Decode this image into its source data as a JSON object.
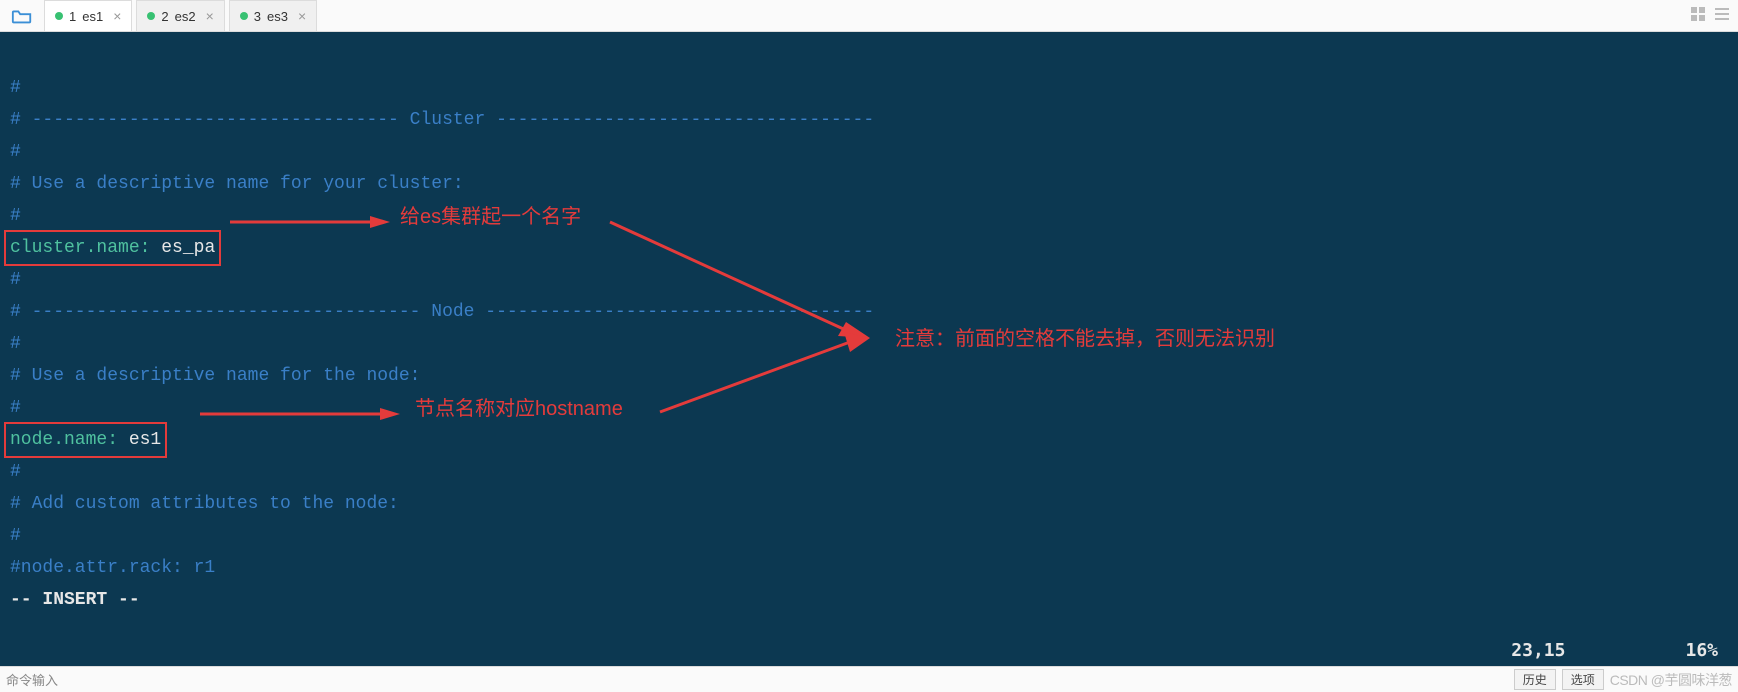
{
  "tabs": [
    {
      "index": "1",
      "name": "es1",
      "active": true
    },
    {
      "index": "2",
      "name": "es2",
      "active": false
    },
    {
      "index": "3",
      "name": "es3",
      "active": false
    }
  ],
  "lines": {
    "l1": "#",
    "l2": "# ---------------------------------- Cluster -----------------------------------",
    "l3": "#",
    "l4": "# Use a descriptive name for your cluster:",
    "l5": "#",
    "l6_key": "cluster.name:",
    "l6_val": " es_pa",
    "l7": "#",
    "l8": "# ------------------------------------ Node ------------------------------------",
    "l9": "#",
    "l10": "# Use a descriptive name for the node:",
    "l11": "#",
    "l12_key": "node.name:",
    "l12_val": " es1",
    "l13": "#",
    "l14": "# Add custom attributes to the node:",
    "l15": "#",
    "l16": "#node.attr.rack: r1",
    "mode": "-- INSERT --"
  },
  "status": {
    "pos": "23,15",
    "pct": "16%"
  },
  "annotations": {
    "a1": "给es集群起一个名字",
    "a2": "节点名称对应hostname",
    "a3": "注意：前面的空格不能去掉，否则无法识别"
  },
  "bottom": {
    "prompt": "命令输入",
    "history": "历史",
    "options": "选项",
    "watermark": "CSDN @芋圆味洋葱"
  }
}
